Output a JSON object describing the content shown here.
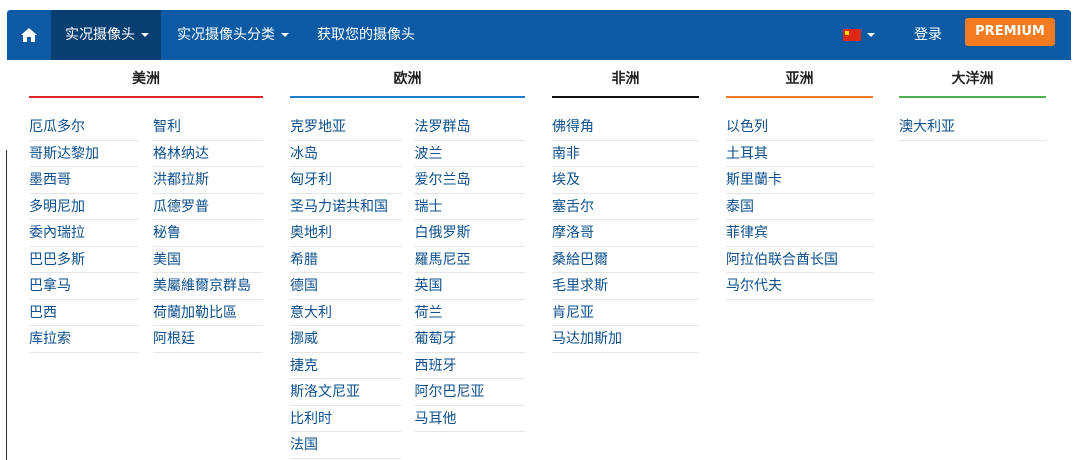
{
  "nav": {
    "home_icon": "home-icon",
    "live_label": "实况摄像头",
    "categories_label": "实况摄像头分类",
    "get_camera_label": "获取您的摄像头",
    "language_flag": "china-flag-icon",
    "login_label": "登录",
    "premium_label": "PREMIUM",
    "colors": {
      "navbar": "#0b5aa3",
      "active": "#0a3f74",
      "premium": "#f47b1f"
    }
  },
  "regions": [
    {
      "title": "美洲",
      "accent": "#d9262b",
      "columns": [
        [
          "厄瓜多尔",
          "哥斯达黎加",
          "墨西哥",
          "多明尼加",
          "委內瑞拉",
          "巴巴多斯",
          "巴拿马",
          "巴西",
          "库拉索"
        ],
        [
          "智利",
          "格林纳达",
          "洪都拉斯",
          "瓜德罗普",
          "秘鲁",
          "美国",
          "美屬維爾京群島",
          "荷蘭加勒比區",
          "阿根廷"
        ]
      ]
    },
    {
      "title": "欧洲",
      "accent": "#1c7cc8",
      "columns": [
        [
          "克罗地亚",
          "冰岛",
          "匈牙利",
          "圣马力诺共和国",
          "奥地利",
          "希腊",
          "德国",
          "意大利",
          "挪威",
          "捷克",
          "斯洛文尼亚",
          "比利时",
          "法国"
        ],
        [
          "法罗群岛",
          "波兰",
          "爱尔兰岛",
          "瑞士",
          "白俄罗斯",
          "羅馬尼亞",
          "英国",
          "荷兰",
          "葡萄牙",
          "西班牙",
          "阿尔巴尼亚",
          "马耳他"
        ]
      ]
    },
    {
      "title": "非洲",
      "accent": "#111111",
      "columns": [
        [
          "佛得角",
          "南非",
          "埃及",
          "塞舌尔",
          "摩洛哥",
          "桑給巴爾",
          "毛里求斯",
          "肯尼亚",
          "马达加斯加"
        ]
      ]
    },
    {
      "title": "亚洲",
      "accent": "#f47b1f",
      "columns": [
        [
          "以色列",
          "土耳其",
          "斯里蘭卡",
          "泰国",
          "菲律宾",
          "阿拉伯联合酋长国",
          "马尔代夫"
        ]
      ]
    },
    {
      "title": "大洋洲",
      "accent": "#4caf50",
      "columns": [
        [
          "澳大利亚"
        ]
      ]
    }
  ]
}
